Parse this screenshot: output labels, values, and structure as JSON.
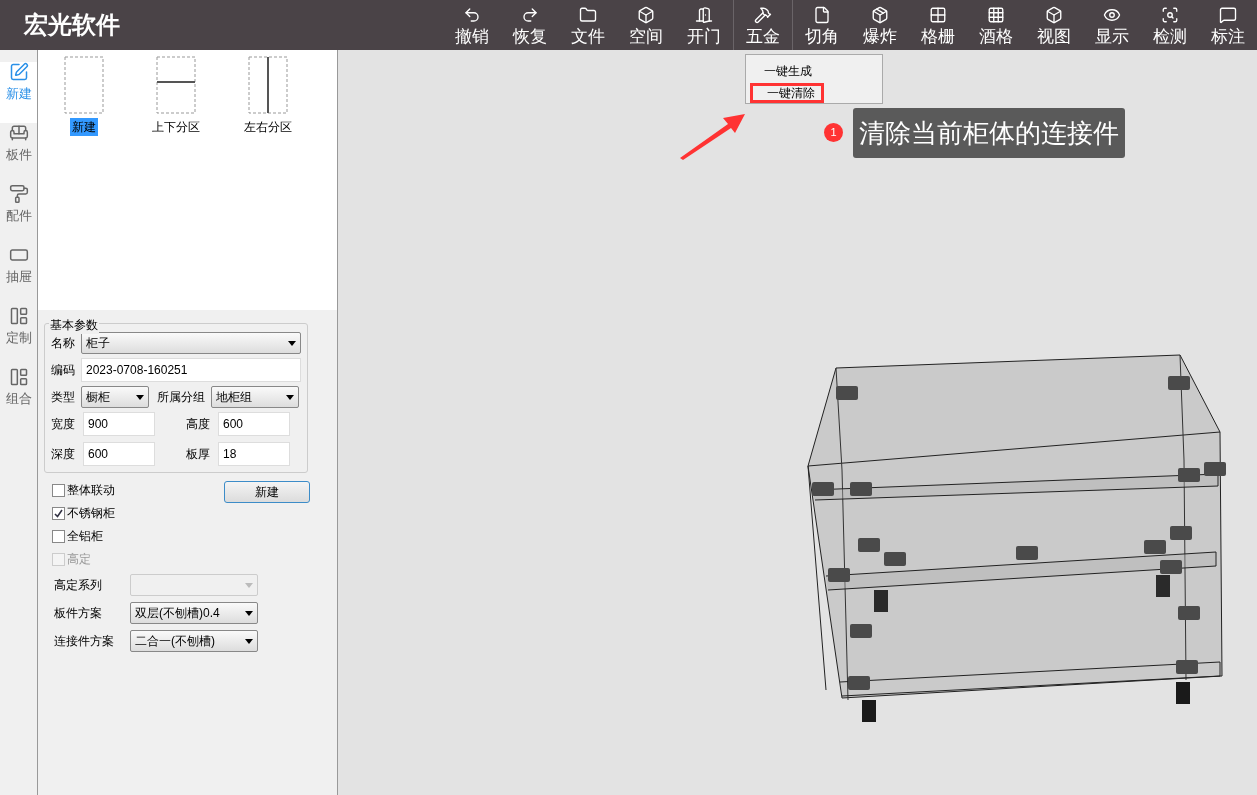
{
  "app_title": "宏光软件",
  "toolbar_groups": [
    {
      "items": [
        {
          "label": "撤销"
        },
        {
          "label": "恢复"
        },
        {
          "label": "文件"
        },
        {
          "label": "空间"
        },
        {
          "label": "开门"
        }
      ]
    },
    {
      "items": [
        {
          "label": "五金"
        }
      ]
    },
    {
      "items": [
        {
          "label": "切角"
        },
        {
          "label": "爆炸"
        },
        {
          "label": "格栅"
        },
        {
          "label": "酒格"
        },
        {
          "label": "视图"
        },
        {
          "label": "显示"
        },
        {
          "label": "检测"
        },
        {
          "label": "标注"
        }
      ]
    }
  ],
  "nav": [
    {
      "label": "新建",
      "selected": true
    },
    {
      "label": "板件",
      "selected": false
    },
    {
      "label": "配件",
      "selected": false
    },
    {
      "label": "抽屉",
      "selected": false
    },
    {
      "label": "定制",
      "selected": false
    },
    {
      "label": "组合",
      "selected": false
    }
  ],
  "templates": [
    {
      "label": "新建",
      "kind": "plain",
      "selected": true
    },
    {
      "label": "上下分区",
      "kind": "horizontal",
      "selected": false
    },
    {
      "label": "左右分区",
      "kind": "vertical",
      "selected": false
    }
  ],
  "basic_params": {
    "title": "基本参数",
    "name": {
      "label": "名称",
      "value": "柜子"
    },
    "code": {
      "label": "编码",
      "value": "2023-0708-160251"
    },
    "type": {
      "label": "类型",
      "value": "橱柜"
    },
    "group": {
      "label": "所属分组",
      "value": "地柜组"
    },
    "dims": [
      {
        "label": "宽度",
        "value": "900"
      },
      {
        "label": "高度",
        "value": "600"
      },
      {
        "label": "深度",
        "value": "600"
      },
      {
        "label": "板厚",
        "value": "18"
      }
    ]
  },
  "options": [
    {
      "label": "整体联动",
      "checked": false,
      "disabled": false
    },
    {
      "label": "不锈钢柜",
      "checked": true,
      "disabled": false
    },
    {
      "label": "全铝柜",
      "checked": false,
      "disabled": false
    },
    {
      "label": "高定",
      "checked": false,
      "disabled": true
    }
  ],
  "create_button": "新建",
  "selects": [
    {
      "label": "高定系列",
      "disabled": true
    },
    {
      "label": "板件方案",
      "value": "双层(不刨槽)0.4",
      "disabled": false
    },
    {
      "label": "连接件方案",
      "value": "二合一(不刨槽)",
      "disabled": false
    }
  ],
  "hardware_menu": {
    "items": [
      {
        "label": "一键生成",
        "highlighted": false
      },
      {
        "label": "一键清除",
        "highlighted": true
      }
    ]
  },
  "callout": {
    "number": "1",
    "text": "清除当前柜体的连接件"
  }
}
